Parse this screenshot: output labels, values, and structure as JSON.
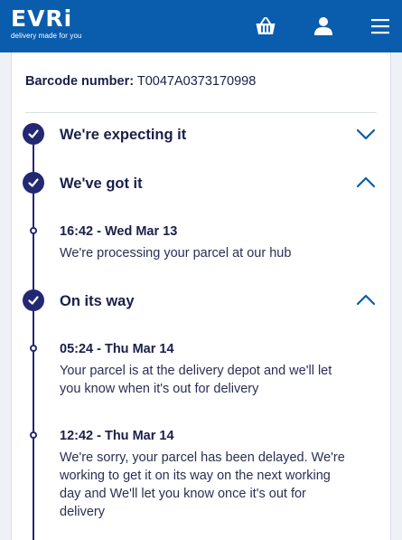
{
  "header": {
    "logo_text": "EVRi",
    "tagline": "delivery made for you",
    "icons": [
      "basket-icon",
      "account-icon",
      "menu-icon"
    ],
    "brand_color": "#0a5cad"
  },
  "tracking": {
    "barcode_label": "Barcode number:",
    "barcode_value": "T0047A0373170998",
    "stages": [
      {
        "title": "We're expecting it",
        "expanded": false,
        "events": []
      },
      {
        "title": "We've got it",
        "expanded": true,
        "events": [
          {
            "time": "16:42 - Wed Mar 13",
            "text": "We're processing your parcel at our hub"
          }
        ]
      },
      {
        "title": "On its way",
        "expanded": true,
        "events": [
          {
            "time": "05:24 - Thu Mar 14",
            "text": "Your parcel is at the delivery depot and we'll let you know when it's out for delivery"
          },
          {
            "time": "12:42 - Thu Mar 14",
            "text": "We're sorry, your parcel has been delayed. We're working to get it on its way on the next working day and We'll let you know once it's out for delivery"
          }
        ]
      }
    ],
    "accent_color": "#232873"
  }
}
